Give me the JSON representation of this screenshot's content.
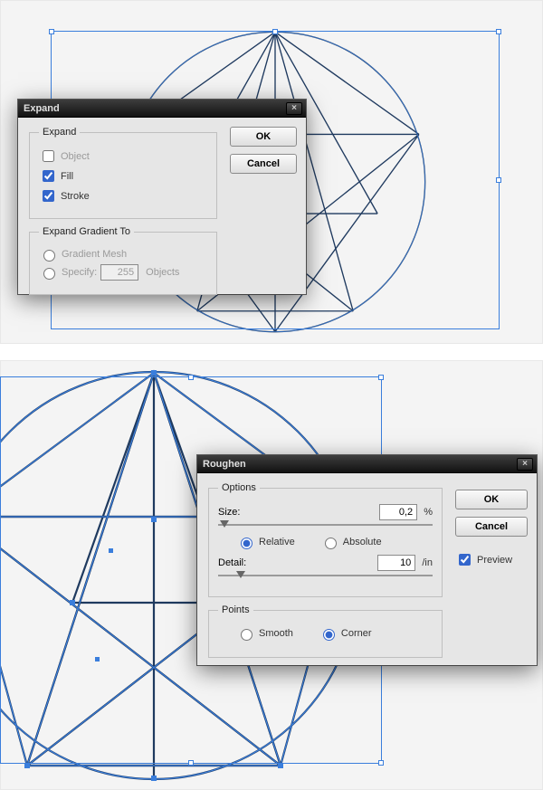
{
  "dialogs": {
    "expand": {
      "title": "Expand",
      "group1": {
        "legend": "Expand",
        "object": {
          "label": "Object",
          "checked": false
        },
        "fill": {
          "label": "Fill",
          "checked": true
        },
        "stroke": {
          "label": "Stroke",
          "checked": true
        }
      },
      "group2": {
        "legend": "Expand Gradient To",
        "gradient_mesh": {
          "label": "Gradient Mesh",
          "checked": false
        },
        "specify": {
          "label": "Specify:",
          "value": "255",
          "unit": "Objects",
          "checked": false
        }
      },
      "buttons": {
        "ok": "OK",
        "cancel": "Cancel"
      }
    },
    "roughen": {
      "title": "Roughen",
      "options": {
        "legend": "Options",
        "size": {
          "label": "Size:",
          "value": "0,2",
          "unit": "%"
        },
        "relative": {
          "label": "Relative",
          "checked": true
        },
        "absolute": {
          "label": "Absolute",
          "checked": false
        },
        "detail": {
          "label": "Detail:",
          "value": "10",
          "unit": "/in"
        }
      },
      "points": {
        "legend": "Points",
        "smooth": {
          "label": "Smooth",
          "checked": false
        },
        "corner": {
          "label": "Corner",
          "checked": true
        }
      },
      "buttons": {
        "ok": "OK",
        "cancel": "Cancel"
      },
      "preview": {
        "label": "Preview",
        "checked": true
      }
    }
  }
}
